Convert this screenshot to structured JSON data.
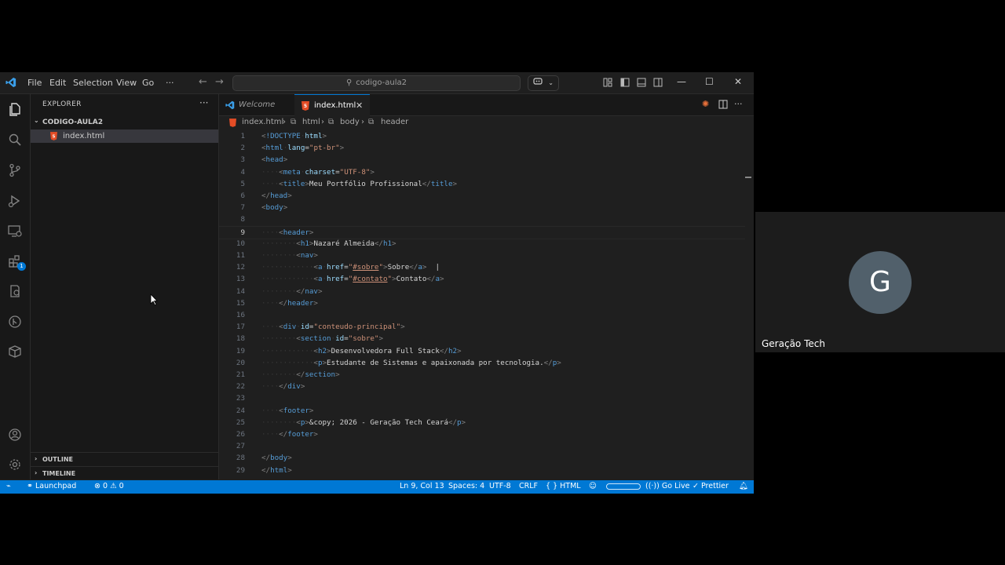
{
  "window": {
    "menu": [
      "File",
      "Edit",
      "Selection",
      "View",
      "Go",
      "···"
    ],
    "search_text": "codigo-aula2"
  },
  "sidebar": {
    "title": "EXPLORER",
    "more": "···",
    "folder": "CODIGO-AULA2",
    "file": "index.html",
    "outline": "OUTLINE",
    "timeline": "TIMELINE",
    "extensions_badge": "1"
  },
  "tabs": [
    {
      "label": "Welcome",
      "active": false
    },
    {
      "label": "index.html",
      "active": true,
      "close": "✕"
    }
  ],
  "breadcrumb": [
    "index.html",
    "html",
    "body",
    "header"
  ],
  "code_lines": [
    {
      "n": "1",
      "parts": [
        [
          "tg",
          "<"
        ],
        [
          "t",
          "!DOCTYPE"
        ],
        [
          "ws",
          "·"
        ],
        [
          "a",
          "html"
        ],
        [
          "tg",
          ">"
        ]
      ]
    },
    {
      "n": "2",
      "parts": [
        [
          "tg",
          "<"
        ],
        [
          "t",
          "html"
        ],
        [
          "ws",
          "·"
        ],
        [
          "a",
          "lang"
        ],
        [
          "tx",
          "="
        ],
        [
          "s",
          "\"pt-br\""
        ],
        [
          "tg",
          ">"
        ]
      ]
    },
    {
      "n": "3",
      "parts": [
        [
          "tg",
          "<"
        ],
        [
          "t",
          "head"
        ],
        [
          "tg",
          ">"
        ]
      ]
    },
    {
      "n": "4",
      "parts": [
        [
          "ws",
          "····"
        ],
        [
          "tg",
          "<"
        ],
        [
          "t",
          "meta"
        ],
        [
          "ws",
          "·"
        ],
        [
          "a",
          "charset"
        ],
        [
          "tx",
          "="
        ],
        [
          "s",
          "\"UTF-8\""
        ],
        [
          "tg",
          ">"
        ]
      ]
    },
    {
      "n": "5",
      "parts": [
        [
          "ws",
          "····"
        ],
        [
          "tg",
          "<"
        ],
        [
          "t",
          "title"
        ],
        [
          "tg",
          ">"
        ],
        [
          "tx",
          "Meu Portfólio Profissional"
        ],
        [
          "tg",
          "</"
        ],
        [
          "t",
          "title"
        ],
        [
          "tg",
          ">"
        ]
      ]
    },
    {
      "n": "6",
      "parts": [
        [
          "tg",
          "</"
        ],
        [
          "t",
          "head"
        ],
        [
          "tg",
          ">"
        ]
      ]
    },
    {
      "n": "7",
      "parts": [
        [
          "tg",
          "<"
        ],
        [
          "t",
          "body"
        ],
        [
          "tg",
          ">"
        ]
      ]
    },
    {
      "n": "8",
      "parts": []
    },
    {
      "n": "9",
      "parts": [
        [
          "ws",
          "····"
        ],
        [
          "tg",
          "<"
        ],
        [
          "t",
          "header"
        ],
        [
          "tg",
          ">"
        ]
      ]
    },
    {
      "n": "10",
      "parts": [
        [
          "ws",
          "········"
        ],
        [
          "tg",
          "<"
        ],
        [
          "t",
          "h1"
        ],
        [
          "tg",
          ">"
        ],
        [
          "tx",
          "Nazaré Almeida"
        ],
        [
          "tg",
          "</"
        ],
        [
          "t",
          "h1"
        ],
        [
          "tg",
          ">"
        ]
      ]
    },
    {
      "n": "11",
      "parts": [
        [
          "ws",
          "········"
        ],
        [
          "tg",
          "<"
        ],
        [
          "t",
          "nav"
        ],
        [
          "tg",
          ">"
        ]
      ]
    },
    {
      "n": "12",
      "parts": [
        [
          "ws",
          "············"
        ],
        [
          "tg",
          "<"
        ],
        [
          "t",
          "a"
        ],
        [
          "ws",
          "·"
        ],
        [
          "a",
          "href"
        ],
        [
          "tx",
          "="
        ],
        [
          "s",
          "\""
        ],
        [
          "su",
          "#sobre"
        ],
        [
          "s",
          "\""
        ],
        [
          "tg",
          ">"
        ],
        [
          "tx",
          "Sobre"
        ],
        [
          "tg",
          "</"
        ],
        [
          "t",
          "a"
        ],
        [
          "tg",
          ">"
        ],
        [
          "tx",
          "  |"
        ]
      ]
    },
    {
      "n": "13",
      "parts": [
        [
          "ws",
          "············"
        ],
        [
          "tg",
          "<"
        ],
        [
          "t",
          "a"
        ],
        [
          "ws",
          "·"
        ],
        [
          "a",
          "href"
        ],
        [
          "tx",
          "="
        ],
        [
          "s",
          "\""
        ],
        [
          "su",
          "#contato"
        ],
        [
          "s",
          "\""
        ],
        [
          "tg",
          ">"
        ],
        [
          "tx",
          "Contato"
        ],
        [
          "tg",
          "</"
        ],
        [
          "t",
          "a"
        ],
        [
          "tg",
          ">"
        ]
      ]
    },
    {
      "n": "14",
      "parts": [
        [
          "ws",
          "········"
        ],
        [
          "tg",
          "</"
        ],
        [
          "t",
          "nav"
        ],
        [
          "tg",
          ">"
        ]
      ]
    },
    {
      "n": "15",
      "parts": [
        [
          "ws",
          "····"
        ],
        [
          "tg",
          "</"
        ],
        [
          "t",
          "header"
        ],
        [
          "tg",
          ">"
        ]
      ]
    },
    {
      "n": "16",
      "parts": []
    },
    {
      "n": "17",
      "parts": [
        [
          "ws",
          "····"
        ],
        [
          "tg",
          "<"
        ],
        [
          "t",
          "div"
        ],
        [
          "ws",
          "·"
        ],
        [
          "a",
          "id"
        ],
        [
          "tx",
          "="
        ],
        [
          "s",
          "\"conteudo-principal\""
        ],
        [
          "tg",
          ">"
        ]
      ]
    },
    {
      "n": "18",
      "parts": [
        [
          "ws",
          "········"
        ],
        [
          "tg",
          "<"
        ],
        [
          "t",
          "section"
        ],
        [
          "ws",
          "·"
        ],
        [
          "a",
          "id"
        ],
        [
          "tx",
          "="
        ],
        [
          "s",
          "\"sobre\""
        ],
        [
          "tg",
          ">"
        ]
      ]
    },
    {
      "n": "19",
      "parts": [
        [
          "ws",
          "············"
        ],
        [
          "tg",
          "<"
        ],
        [
          "t",
          "h2"
        ],
        [
          "tg",
          ">"
        ],
        [
          "tx",
          "Desenvolvedora Full Stack"
        ],
        [
          "tg",
          "</"
        ],
        [
          "t",
          "h2"
        ],
        [
          "tg",
          ">"
        ]
      ]
    },
    {
      "n": "20",
      "parts": [
        [
          "ws",
          "············"
        ],
        [
          "tg",
          "<"
        ],
        [
          "t",
          "p"
        ],
        [
          "tg",
          ">"
        ],
        [
          "tx",
          "Estudante de Sistemas e apaixonada por tecnologia."
        ],
        [
          "tg",
          "</"
        ],
        [
          "t",
          "p"
        ],
        [
          "tg",
          ">"
        ]
      ]
    },
    {
      "n": "21",
      "parts": [
        [
          "ws",
          "········"
        ],
        [
          "tg",
          "</"
        ],
        [
          "t",
          "section"
        ],
        [
          "tg",
          ">"
        ]
      ]
    },
    {
      "n": "22",
      "parts": [
        [
          "ws",
          "····"
        ],
        [
          "tg",
          "</"
        ],
        [
          "t",
          "div"
        ],
        [
          "tg",
          ">"
        ]
      ]
    },
    {
      "n": "23",
      "parts": []
    },
    {
      "n": "24",
      "parts": [
        [
          "ws",
          "····"
        ],
        [
          "tg",
          "<"
        ],
        [
          "t",
          "footer"
        ],
        [
          "tg",
          ">"
        ]
      ]
    },
    {
      "n": "25",
      "parts": [
        [
          "ws",
          "········"
        ],
        [
          "tg",
          "<"
        ],
        [
          "t",
          "p"
        ],
        [
          "tg",
          ">"
        ],
        [
          "tx",
          "&copy; 2026 - Geração Tech Ceará"
        ],
        [
          "tg",
          "</"
        ],
        [
          "t",
          "p"
        ],
        [
          "tg",
          ">"
        ]
      ]
    },
    {
      "n": "26",
      "parts": [
        [
          "ws",
          "····"
        ],
        [
          "tg",
          "</"
        ],
        [
          "t",
          "footer"
        ],
        [
          "tg",
          ">"
        ]
      ]
    },
    {
      "n": "27",
      "parts": []
    },
    {
      "n": "28",
      "parts": [
        [
          "tg",
          "</"
        ],
        [
          "t",
          "body"
        ],
        [
          "tg",
          ">"
        ]
      ]
    },
    {
      "n": "29",
      "parts": [
        [
          "tg",
          "</"
        ],
        [
          "t",
          "html"
        ],
        [
          "tg",
          ">"
        ]
      ]
    }
  ],
  "current_line": "9",
  "status": {
    "remote": "⌁",
    "launchpad": "Launchpad",
    "errors": "0",
    "warnings": "0",
    "position": "Ln 9, Col 13",
    "spaces": "Spaces: 4",
    "encoding": "UTF-8",
    "eol": "CRLF",
    "language": "HTML",
    "golive": "Go Live",
    "prettier": "Prettier"
  },
  "participant": {
    "initial": "G",
    "name": "Geração Tech",
    "avatar_color": "#51606b"
  },
  "colors": {
    "accent": "#0078d4",
    "statusbar": "#0078d4",
    "editor_bg": "#1f1f1f",
    "html5_icon": "#e44d26"
  }
}
